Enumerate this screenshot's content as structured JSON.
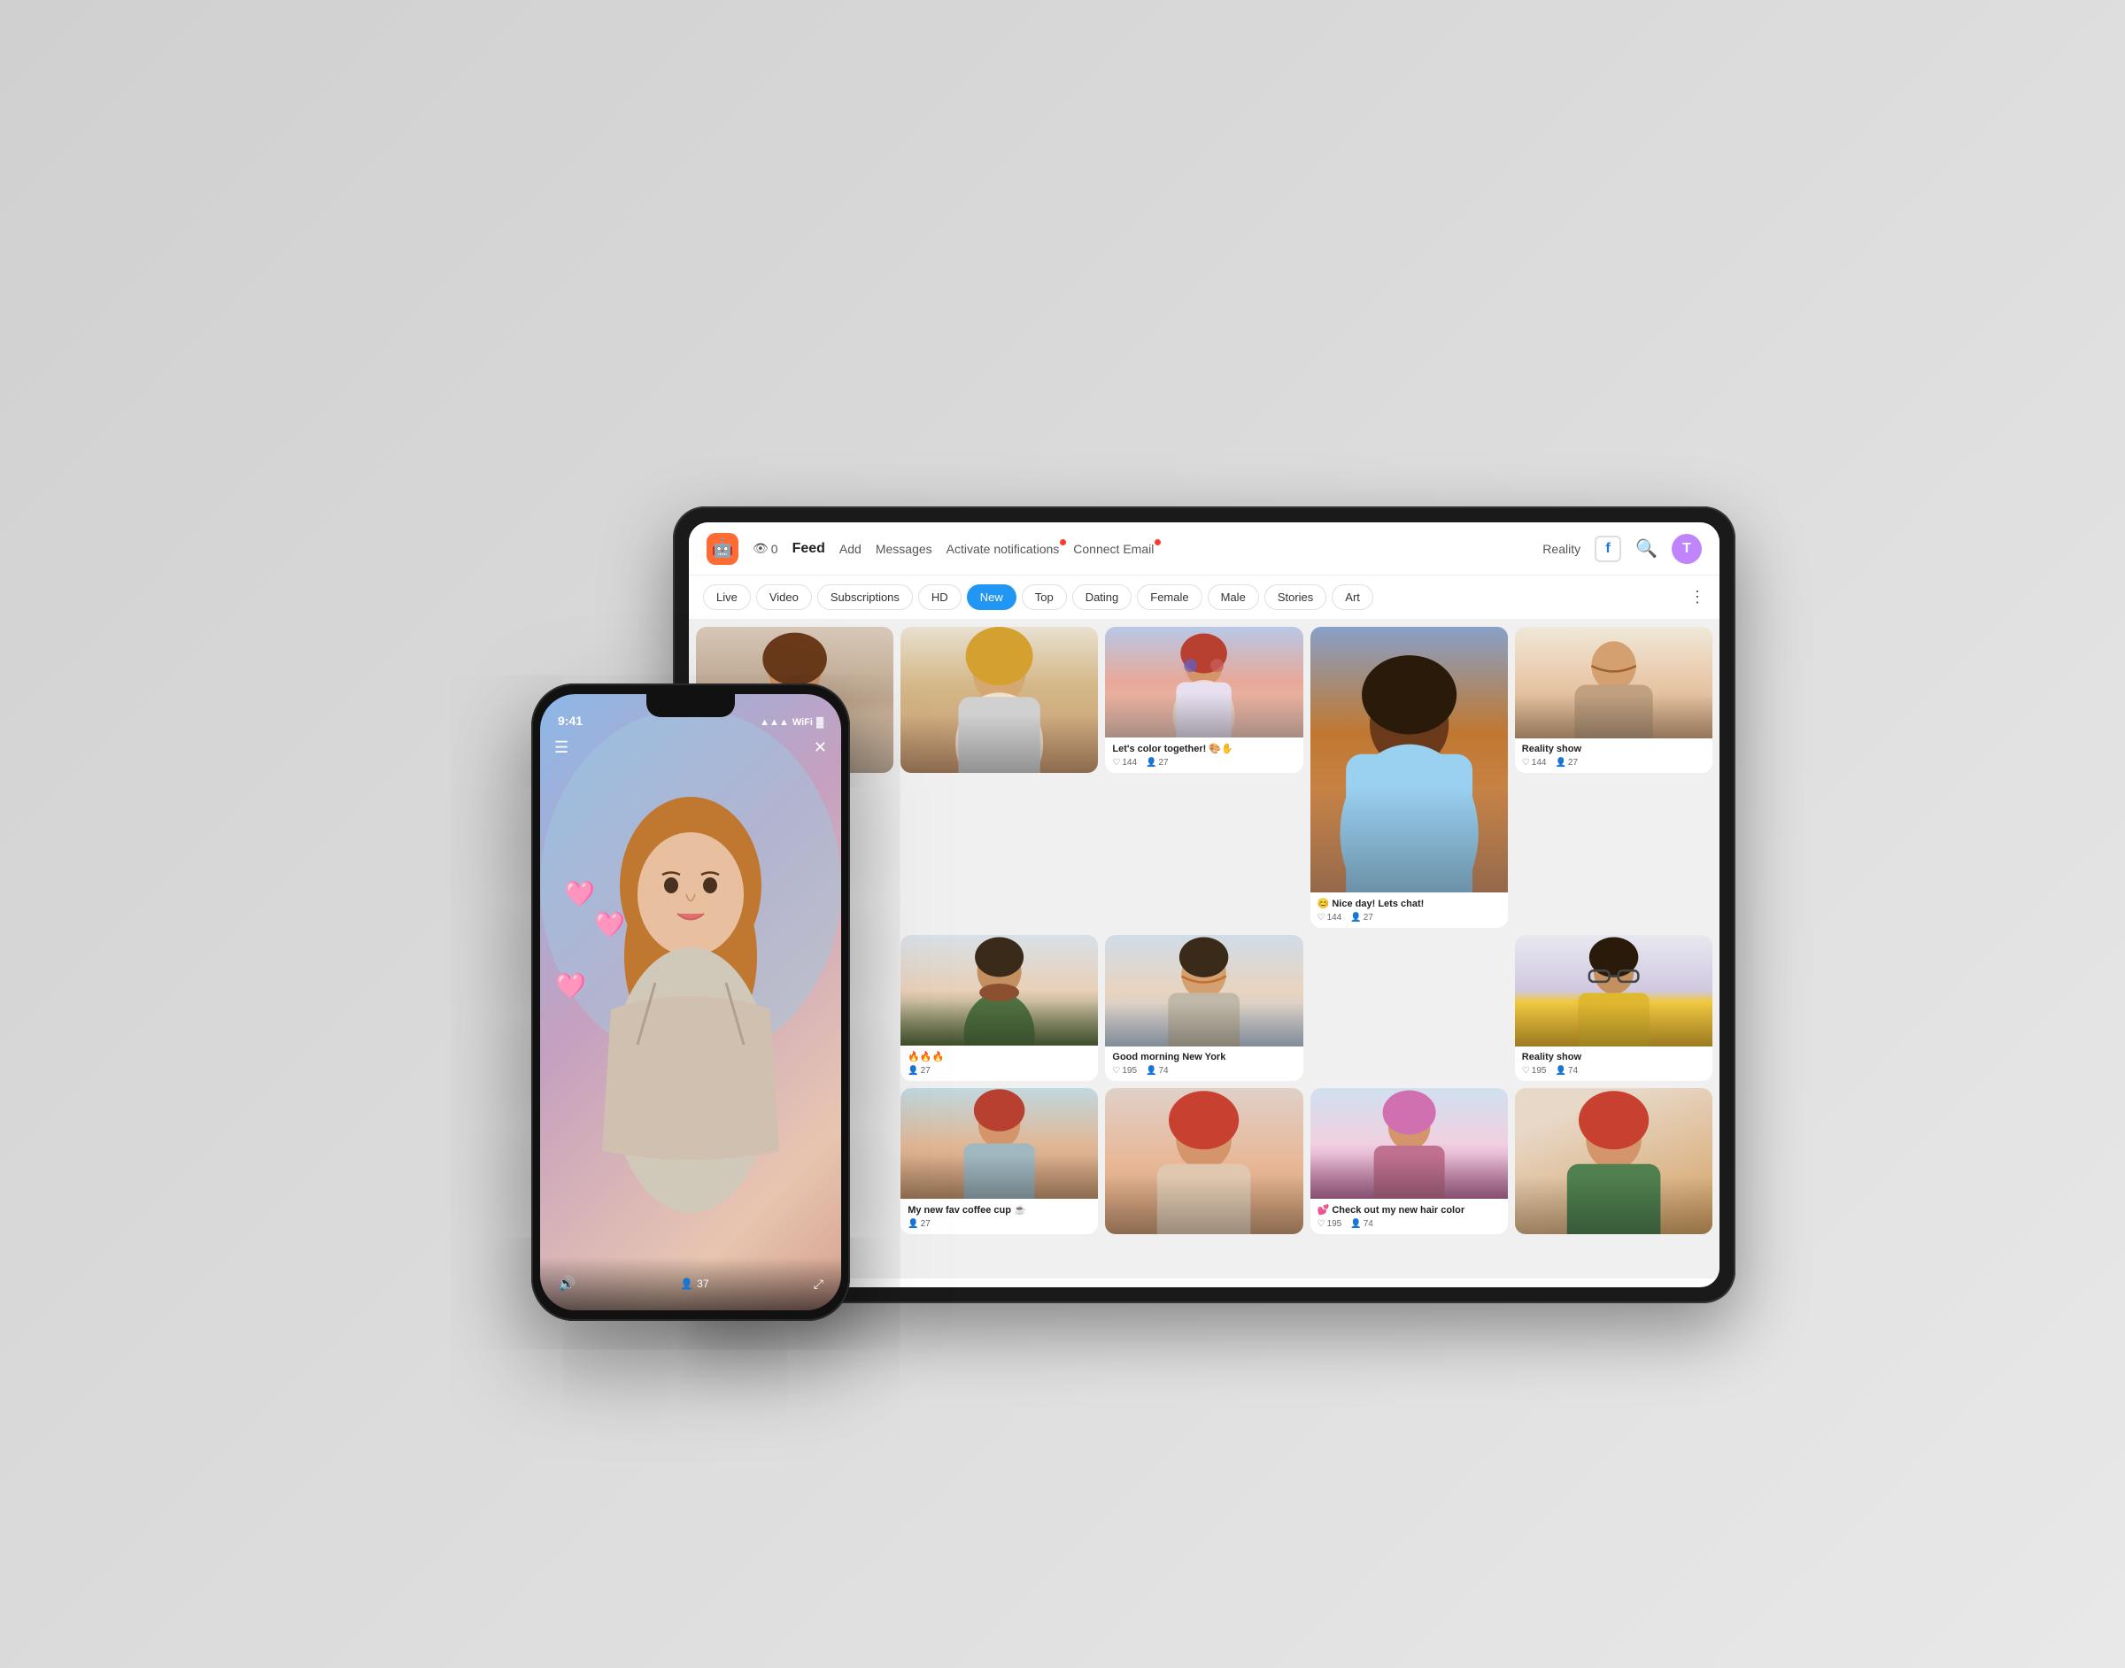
{
  "app": {
    "icon": "🤖",
    "zero_label": "0",
    "nav": {
      "feed": "Feed",
      "add": "Add",
      "messages": "Messages",
      "activate_notifications": "Activate notifications",
      "connect_email": "Connect Email",
      "reality": "Reality"
    },
    "avatar_letter": "T"
  },
  "filters": {
    "tabs": [
      "Live",
      "Video",
      "Subscriptions",
      "HD",
      "New",
      "Top",
      "Dating",
      "Female",
      "Male",
      "Stories",
      "Art"
    ],
    "active": "New"
  },
  "cards": [
    {
      "id": "c1",
      "title": "",
      "likes": "",
      "viewers": "",
      "col": 1,
      "row": 1,
      "span": 1,
      "color": "c-brunette",
      "height": "tall"
    },
    {
      "id": "c2",
      "title": "",
      "likes": "",
      "viewers": "",
      "col": 2,
      "row": 1,
      "span": 2,
      "color": "c-blonde",
      "height": "tall"
    },
    {
      "id": "c3",
      "title": "Let's color together! 🎨✋",
      "likes": "144",
      "viewers": "27",
      "col": 3,
      "row": 1,
      "span": 1,
      "color": "c-redhead-blue",
      "height": "short"
    },
    {
      "id": "c4",
      "title": "Nice day! Lets chat!",
      "likes": "144",
      "viewers": "27",
      "emoji": "😊",
      "col": 4,
      "row": 1,
      "span": 2,
      "color": "c-black-woman",
      "height": "tall"
    },
    {
      "id": "c5",
      "title": "Reality show",
      "likes": "144",
      "viewers": "27",
      "col": 5,
      "row": 1,
      "span": 1,
      "color": "c-man-smiling",
      "height": "short"
    },
    {
      "id": "c6",
      "title": "🔥🔥🔥",
      "viewers": "27",
      "col": 2,
      "row": 2,
      "color": "c-bearded-man",
      "height": "short"
    },
    {
      "id": "c7",
      "title": "Good morning New York",
      "likes": "195",
      "viewers": "74",
      "col": 3,
      "row": 2,
      "color": "c-man-selfie",
      "height": "short"
    },
    {
      "id": "c8",
      "title": "Reality show",
      "likes": "195",
      "viewers": "74",
      "col": 5,
      "row": 2,
      "color": "c-woman-glasses",
      "height": "short"
    },
    {
      "id": "c9",
      "title": "My new fav coffee cup ☕",
      "viewers": "27",
      "col": 2,
      "row": 3,
      "color": "c-redhead-coffee",
      "height": "short"
    },
    {
      "id": "c10",
      "title": "",
      "col": 3,
      "row": 3,
      "color": "c-redhead-pretty",
      "height": "short"
    },
    {
      "id": "c11",
      "title": "Check out my new hair color",
      "emoji": "💕",
      "likes": "195",
      "viewers": "74",
      "col": 4,
      "row": 3,
      "color": "c-pink-hair",
      "height": "short"
    },
    {
      "id": "c12",
      "title": "",
      "col": 5,
      "row": 3,
      "color": "c-redhead-blue",
      "height": "short"
    }
  ],
  "phone": {
    "time": "9:41",
    "signal": "▲▲▲",
    "wifi": "WiFi",
    "battery": "100%",
    "viewers": "37",
    "volume_icon": "🔊",
    "fullscreen_icon": "⤢"
  }
}
